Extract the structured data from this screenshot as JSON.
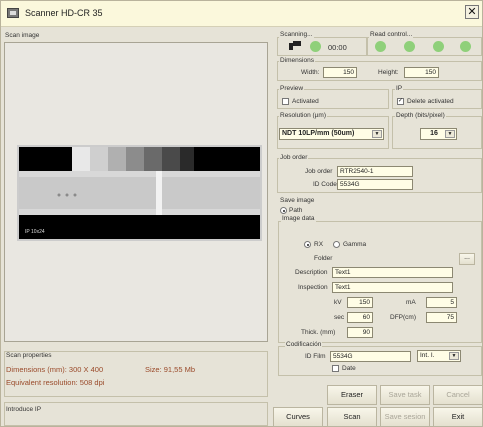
{
  "window": {
    "title": "Scanner HD-CR 35",
    "close": "✕"
  },
  "scan_image": {
    "title": "Scan image",
    "plate_label": "IP 10x24"
  },
  "scanning": {
    "title": "Scanning...",
    "time": "00:00",
    "icon": "scanner-icon"
  },
  "read_control": {
    "title": "Read control..."
  },
  "dimensions": {
    "title": "Dimensions",
    "width_label": "Width:",
    "width_value": "150",
    "height_label": "Height:",
    "height_value": "150"
  },
  "preview": {
    "title": "Preview",
    "activated_label": "Activated",
    "activated": false
  },
  "ip": {
    "title": "IP",
    "delete_label": "Delete activated",
    "delete_checked": true
  },
  "resolution": {
    "title": "Resolution (µm)",
    "value": "NDT 10LP/mm (50um)"
  },
  "depth": {
    "title": "Depth (bits/pixel)",
    "value": "16"
  },
  "job_order": {
    "title": "Job order",
    "job_label": "Job order",
    "job_value": "RTR2540-1",
    "id_label": "ID Code",
    "id_value": "5534G"
  },
  "save_image": {
    "title": "Save image",
    "path_label": "Path",
    "image_data_title": "Image data",
    "rx_label": "RX",
    "gamma_label": "Gamma",
    "folder_label": "Folder",
    "folder_button": "...",
    "description_label": "Description",
    "description_value": "Text1",
    "inspection_label": "Inspection",
    "inspection_value": "Text1",
    "kv_label": "kV",
    "kv_value": "150",
    "ma_label": "mA",
    "ma_value": "5",
    "sec_label": "sec",
    "sec_value": "60",
    "dfp_label": "DFP(cm)",
    "dfp_value": "75",
    "thick_label": "Thick. (mm)",
    "thick_value": "90"
  },
  "codificacion": {
    "title": "Codificación",
    "id_film_label": "ID Film",
    "id_film_value": "5534G",
    "combo_value": "Int. I.",
    "date_label": "Date"
  },
  "scan_properties": {
    "title": "Scan properties",
    "dimensions": "Dimensions (mm): 300 X 400",
    "size": "Size: 91,55 Mb",
    "equivalent": "Equivalent resolution: 508 dpi"
  },
  "introduce_ip": {
    "title": "Introduce IP"
  },
  "buttons": {
    "eraser": "Eraser",
    "save_task": "Save task",
    "cancel": "Cancel",
    "curves": "Curves",
    "scan": "Scan",
    "save_session": "Save sesion",
    "exit": "Exit"
  },
  "colors": {
    "led": "#8fd07a",
    "info_text": "#9a4a2a"
  }
}
